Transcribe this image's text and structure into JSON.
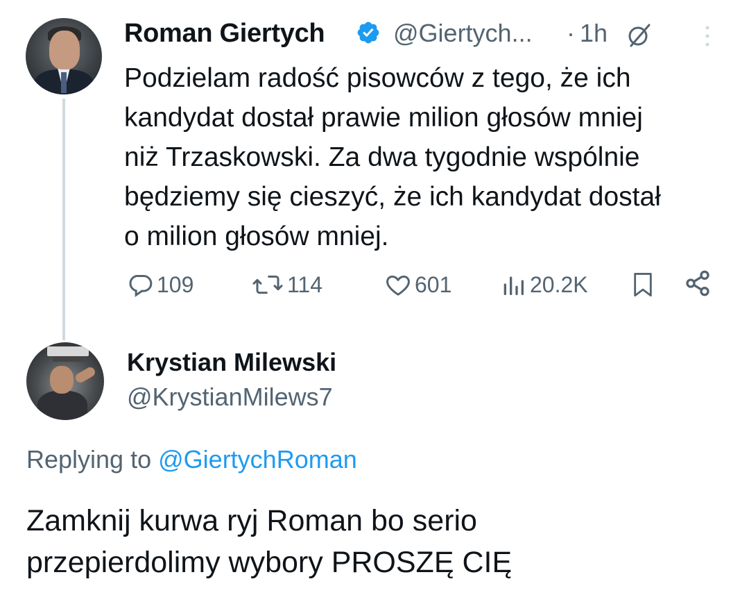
{
  "colors": {
    "text_primary": "#0f1419",
    "text_secondary": "#536471",
    "link": "#1d9bf0",
    "verified": "#1d9bf0",
    "thread_line": "#cfd9de"
  },
  "tweet": {
    "author_name": "Roman Giertych",
    "verified_icon": "verified-badge-icon",
    "handle": "@Giertych...",
    "separator": "·",
    "time": "1h",
    "text": "Podzielam radość pisowców z tego, że ich\nkandydat dostał prawie milion głosów mniej\nniż Trzaskowski. Za dwa tygodnie wspólnie\nbędziemy się cieszyć, że ich kandydat dostał\no milion głosów mniej.",
    "actions": {
      "replies": "109",
      "retweets": "114",
      "likes": "601",
      "views": "20.2K"
    }
  },
  "reply": {
    "author_name": "Krystian Milewski",
    "handle": "@KrystianMilews7",
    "replying_prefix": "Replying to",
    "replying_handle": "@GiertychRoman",
    "text": "Zamknij kurwa ryj Roman bo serio\nprzepierdolimy wybory PROSZĘ CIĘ"
  }
}
